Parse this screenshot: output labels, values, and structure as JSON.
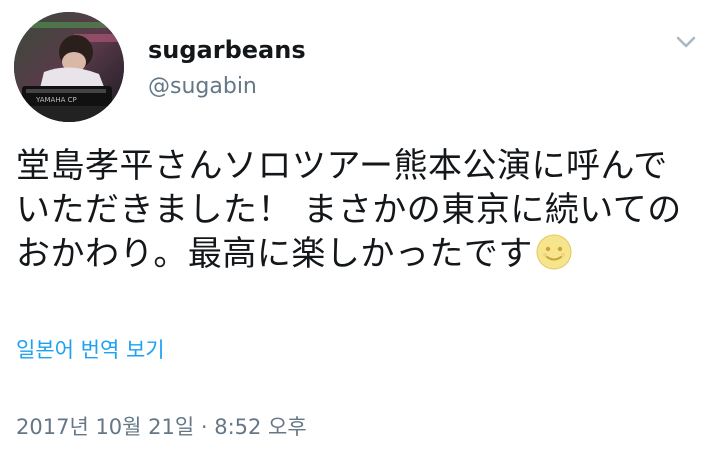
{
  "tweet": {
    "user": {
      "display_name": "sugarbeans",
      "handle": "@sugabin",
      "avatar_icon": "avatar-photo-keyboard-player"
    },
    "text_lines": [
      "堂島孝平さんソロツアー熊本公演に呼んで",
      "いただきました！ まさかの東京に続いての",
      "おかわり。最高に楽しかったです"
    ],
    "emoji": "smiling-moon-face-icon",
    "translate_label": "일본어 번역 보기",
    "timestamp": "2017년 10월 21일 · 8:52 오후",
    "menu_icon": "chevron-down-icon"
  },
  "colors": {
    "text": "#14171a",
    "secondary": "#657786",
    "link": "#1da1f2",
    "background": "#ffffff"
  }
}
